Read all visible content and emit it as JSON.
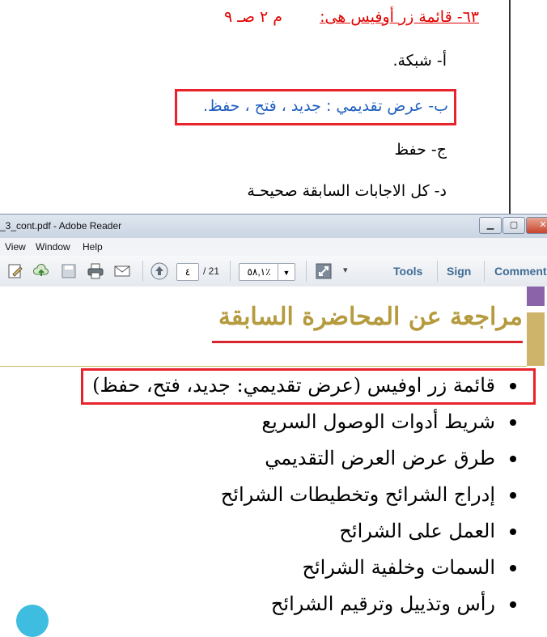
{
  "question": {
    "title": "٦٣- قائمة زر أوفيس هى:",
    "reference": "م ٢ صـ ٩",
    "options": [
      {
        "label": "أ- شبكة."
      },
      {
        "label": "ب- عرض تقديمي : جديد ، فتح ، حفظ."
      },
      {
        "label": "ج- حفظ"
      },
      {
        "label": "د- كل الاجابات السابقة صحيحـة"
      }
    ]
  },
  "window": {
    "title": "_3_cont.pdf - Adobe Reader",
    "menu": [
      "View",
      "Window",
      "Help"
    ],
    "toolbar": {
      "page_current": "٤",
      "page_total": "/ 21",
      "zoom": "٥٨,١٪",
      "tools_label": "Tools",
      "sign_label": "Sign",
      "comment_label": "Comment"
    }
  },
  "slide": {
    "heading": "مراجعة عن المحاضرة السابقة",
    "bullets": [
      "قائمة زر اوفيس (عرض تقديمي: جديد، فتح، حفظ)",
      "شريط أدوات الوصول السريع",
      "طرق عرض العرض التقديمي",
      "إدراج الشرائح وتخطيطات الشرائح",
      "العمل على الشرائح",
      "السمات وخلفية الشرائح",
      "رأس وتذييل وترقيم الشرائح"
    ]
  },
  "colors": {
    "highlight_box": "#e8232b",
    "question_title": "#e00000",
    "selected_option": "#1f5fbf",
    "heading": "#b59a3e"
  }
}
